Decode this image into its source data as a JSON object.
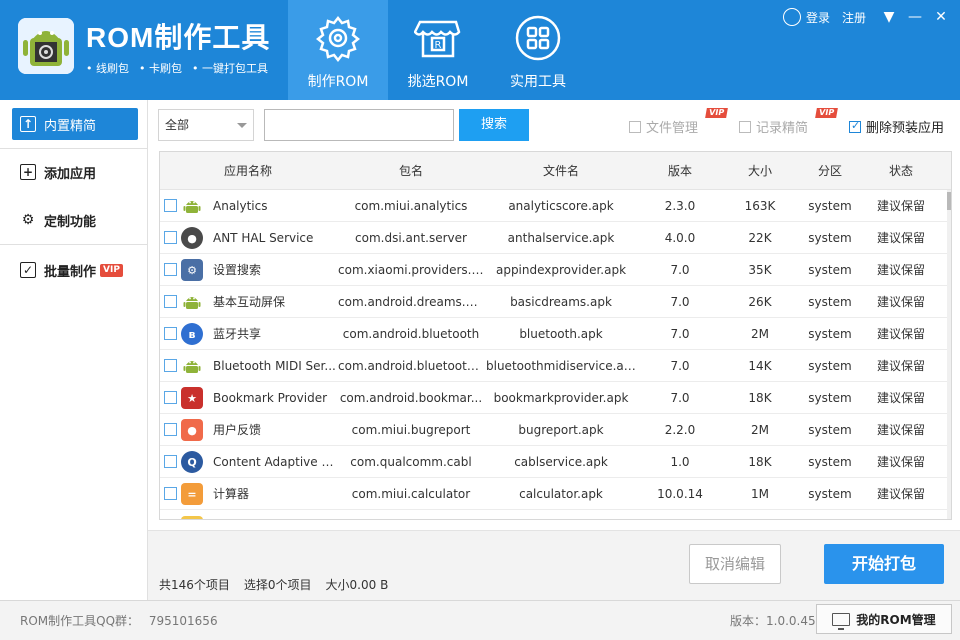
{
  "header": {
    "title": "ROM制作工具",
    "features": [
      "线刷包",
      "卡刷包",
      "一键打包工具"
    ],
    "tabs": [
      {
        "label": "制作ROM",
        "icon": "gear-icon",
        "active": true
      },
      {
        "label": "挑选ROM",
        "icon": "store-icon",
        "active": false
      },
      {
        "label": "实用工具",
        "icon": "grid-icon",
        "active": false
      }
    ],
    "login": "登录",
    "register": "注册",
    "accent": "#1e86d8"
  },
  "sidebar": {
    "items": [
      {
        "label": "内置精简",
        "icon": "upload-icon"
      },
      {
        "label": "添加应用",
        "icon": "plus-square-icon"
      },
      {
        "label": "定制功能",
        "icon": "settings-icon"
      },
      {
        "label": "批量制作",
        "icon": "batch-icon",
        "badge": "VIP"
      }
    ]
  },
  "toolbar": {
    "filter_selected": "全部",
    "search_value": "",
    "search_label": "搜索",
    "options": [
      {
        "label": "文件管理",
        "checked": false,
        "vip": "VIP"
      },
      {
        "label": "记录精简",
        "checked": false,
        "vip": "VIP"
      },
      {
        "label": "删除预装应用",
        "checked": true
      }
    ]
  },
  "table": {
    "columns": [
      "应用名称",
      "包名",
      "文件名",
      "版本",
      "大小",
      "分区",
      "状态"
    ],
    "rows": [
      {
        "name": "Analytics",
        "pkg": "com.miui.analytics",
        "file": "analyticscore.apk",
        "ver": "2.3.0",
        "size": "163K",
        "part": "system",
        "status": "建议保留",
        "icon": "android-icon",
        "color": "#8fb339"
      },
      {
        "name": "ANT HAL Service",
        "pkg": "com.dsi.ant.server",
        "file": "anthalservice.apk",
        "ver": "4.0.0",
        "size": "22K",
        "part": "system",
        "status": "建议保留",
        "icon": "ant-icon",
        "color": "#4a4a4a"
      },
      {
        "name": "设置搜索",
        "pkg": "com.xiaomi.providers.a...",
        "file": "appindexprovider.apk",
        "ver": "7.0",
        "size": "35K",
        "part": "system",
        "status": "建议保留",
        "icon": "gear-icon",
        "color": "#4a6fa5"
      },
      {
        "name": "基本互动屏保",
        "pkg": "com.android.dreams.b...",
        "file": "basicdreams.apk",
        "ver": "7.0",
        "size": "26K",
        "part": "system",
        "status": "建议保留",
        "icon": "android-icon",
        "color": "#8fb339"
      },
      {
        "name": "蓝牙共享",
        "pkg": "com.android.bluetooth",
        "file": "bluetooth.apk",
        "ver": "7.0",
        "size": "2M",
        "part": "system",
        "status": "建议保留",
        "icon": "bluetooth-icon",
        "color": "#2f6fd1"
      },
      {
        "name": "Bluetooth MIDI Ser...",
        "pkg": "com.android.bluetooth...",
        "file": "bluetoothmidiservice.apk",
        "ver": "7.0",
        "size": "14K",
        "part": "system",
        "status": "建议保留",
        "icon": "android-icon",
        "color": "#8fb339"
      },
      {
        "name": "Bookmark Provider",
        "pkg": "com.android.bookmar...",
        "file": "bookmarkprovider.apk",
        "ver": "7.0",
        "size": "18K",
        "part": "system",
        "status": "建议保留",
        "icon": "bookmark-icon",
        "color": "#c9302c"
      },
      {
        "name": "用户反馈",
        "pkg": "com.miui.bugreport",
        "file": "bugreport.apk",
        "ver": "2.2.0",
        "size": "2M",
        "part": "system",
        "status": "建议保留",
        "icon": "feedback-icon",
        "color": "#f06a4a"
      },
      {
        "name": "Content Adaptive B...",
        "pkg": "com.qualcomm.cabl",
        "file": "cablservice.apk",
        "ver": "1.0",
        "size": "18K",
        "part": "system",
        "status": "建议保留",
        "icon": "qualcomm-icon",
        "color": "#2c5aa0"
      },
      {
        "name": "计算器",
        "pkg": "com.miui.calculator",
        "file": "calculator.apk",
        "ver": "10.0.14",
        "size": "1M",
        "part": "system",
        "status": "建议保留",
        "icon": "calculator-icon",
        "color": "#f39c3a"
      }
    ]
  },
  "summary": {
    "total": "共146个项目",
    "selected": "选择0个项目",
    "size": "大小0.00 B"
  },
  "actions": {
    "cancel_label": "取消编辑",
    "start_label": "开始打包"
  },
  "footer": {
    "qq_label": "ROM制作工具QQ群：",
    "qq_number": "795101656",
    "version": "版本：1.0.0.45",
    "my_rom_label": "我的ROM管理"
  }
}
